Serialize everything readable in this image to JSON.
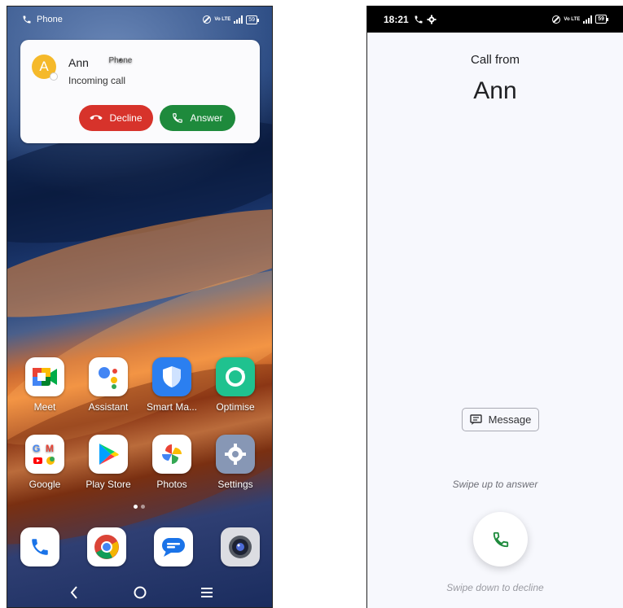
{
  "left_screen": {
    "status_bar": {
      "app_label": "Phone",
      "battery": "59",
      "network": "4G",
      "volte": "Vo LTE"
    },
    "notification": {
      "avatar_letter": "A",
      "caller_name": "Ann",
      "separator": " • ",
      "app_name": "Phone",
      "subtitle": "Incoming call",
      "decline_label": "Decline",
      "answer_label": "Answer",
      "decline_color": "#d7332b",
      "answer_color": "#1e8a3c"
    },
    "apps_row1": [
      {
        "label": "Meet",
        "icon": "meet-icon"
      },
      {
        "label": "Assistant",
        "icon": "assistant-icon"
      },
      {
        "label": "Smart Ma...",
        "icon": "smart-manager-icon"
      },
      {
        "label": "Optimise",
        "icon": "optimise-icon"
      }
    ],
    "apps_row2": [
      {
        "label": "Google",
        "icon": "google-folder-icon"
      },
      {
        "label": "Play Store",
        "icon": "play-store-icon"
      },
      {
        "label": "Photos",
        "icon": "photos-icon"
      },
      {
        "label": "Settings",
        "icon": "settings-icon"
      }
    ],
    "dock": [
      {
        "icon": "phone-icon"
      },
      {
        "icon": "chrome-icon"
      },
      {
        "icon": "messages-icon"
      },
      {
        "icon": "camera-icon"
      }
    ]
  },
  "right_screen": {
    "status_bar": {
      "time": "18:21",
      "battery": "59",
      "network": "4G",
      "volte": "Vo LTE"
    },
    "call_from_label": "Call from",
    "caller_name": "Ann",
    "message_button_label": "Message",
    "swipe_up_hint": "Swipe up to answer",
    "swipe_down_hint": "Swipe down to decline",
    "answer_icon_color": "#1e8a3c"
  }
}
